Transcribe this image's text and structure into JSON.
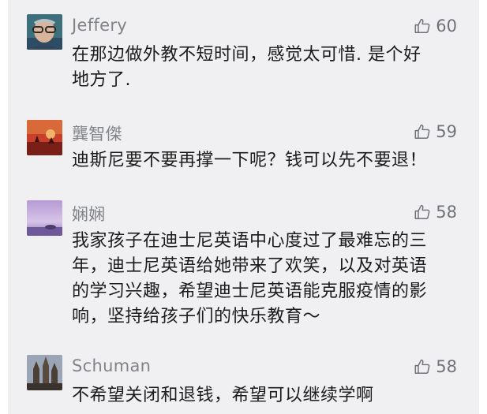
{
  "comments": [
    {
      "author": "Jeffery",
      "likes": "60",
      "text": "在那边做外教不短时间，感觉太可惜. 是个好\n地方了.",
      "avatar": "avatar-man-glasses"
    },
    {
      "author": "龔智傑",
      "likes": "59",
      "text": "迪斯尼要不要再撑一下呢？钱可以先不要退！",
      "avatar": "avatar-red-sunset"
    },
    {
      "author": "娴娴",
      "likes": "58",
      "text": "我家孩子在迪士尼英语中心度过了最难忘的三\n年，迪士尼英语给她带来了欢笑，以及对英语\n的学习兴趣，希望迪士尼英语能克服疫情的影\n响，坚持给孩子们的快乐教育～",
      "avatar": "avatar-purple-sky"
    },
    {
      "author": "Schuman",
      "likes": "58",
      "text": "不希望关闭和退钱，希望可以继续学啊",
      "avatar": "avatar-cathedral"
    }
  ],
  "colors": {
    "background": "#f0f0f3",
    "author": "#808388",
    "text": "#1b1b1b",
    "like": "#6f7278"
  },
  "icons": {
    "like": "thumbs-up-outline-icon"
  }
}
